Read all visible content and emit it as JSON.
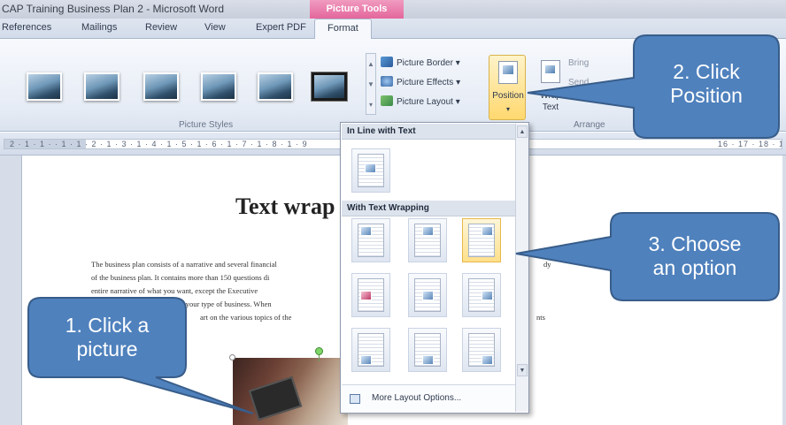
{
  "window": {
    "title": "CAP Training Business Plan 2 - Microsoft Word",
    "contextual_tab_group": "Picture Tools"
  },
  "tabs": [
    {
      "label": "References"
    },
    {
      "label": "Mailings"
    },
    {
      "label": "Review"
    },
    {
      "label": "View"
    },
    {
      "label": "Expert PDF"
    },
    {
      "label": "Format",
      "active": true
    }
  ],
  "ribbon": {
    "picture_border_label": "Picture Border",
    "picture_effects_label": "Picture Effects",
    "picture_layout_label": "Picture Layout",
    "picture_styles_group": "Picture Styles",
    "position_label": "Position",
    "wrap_text_label": "Wrap Text",
    "bring_forward_label": "Bring",
    "send_backward_label": "Send",
    "arrange_group": "Arrange"
  },
  "ruler": {
    "ticks": "2 · 1 · 1 · · 1 · 1 · 2 · 1 · 3 · 1 · 4 · 1 · 5 · 1 · 6 · 1 · 7 · 1 · 8 · 1 · 9",
    "right_ticks": "16 · 17 · 18 · 19"
  },
  "document": {
    "heading": "Text wrap",
    "body_lines": [
      "The business plan consists of a narrative and several financial",
      "of the business plan. It contains more than 150 questions di",
      "entire narrative of what you want, except the Executive",
      "to your type of business. When",
      "art on the various topics of the"
    ],
    "right_lines": [
      "dy",
      "nts"
    ]
  },
  "position_menu": {
    "section_inline": "In Line with Text",
    "section_wrapping": "With Text Wrapping",
    "more_options": "More Layout Options...",
    "selected_option": "top-right"
  },
  "callouts": [
    {
      "id": "step1",
      "lines": [
        "1. Click a",
        "picture"
      ]
    },
    {
      "id": "step2",
      "lines": [
        "2. Click",
        "Position"
      ]
    },
    {
      "id": "step3",
      "lines": [
        "3. Choose",
        "an option"
      ]
    }
  ],
  "colors": {
    "callout_fill": "#4f81bd",
    "callout_border": "#385d8a",
    "highlight": "#ffd86f"
  }
}
